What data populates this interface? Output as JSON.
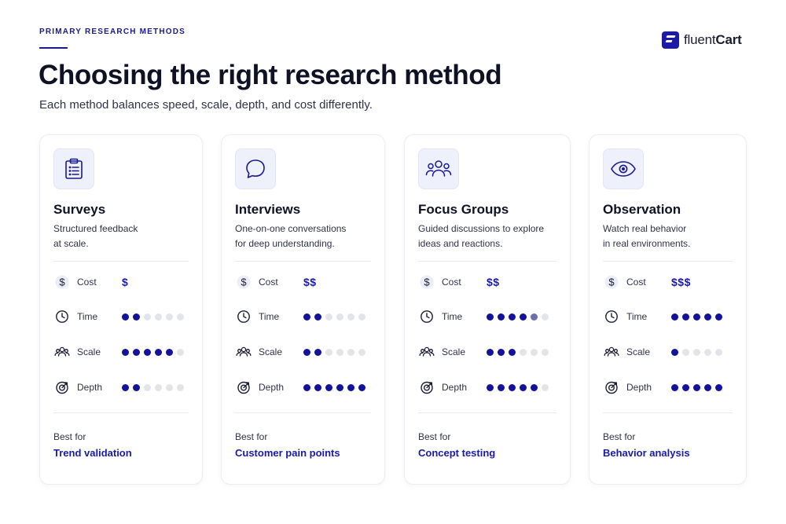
{
  "header": {
    "eyebrow": "PRIMARY RESEARCH METHODS",
    "title": "Choosing the right research method",
    "subtitle": "Each method balances speed, scale, depth, and cost differently."
  },
  "brand": {
    "name_light": "fluent",
    "name_bold": "Cart"
  },
  "labels": {
    "cost": "Cost",
    "time": "Time",
    "scale": "Scale",
    "depth": "Depth",
    "best_for": "Best for"
  },
  "colors": {
    "accent": "#1a1aa6",
    "dot_on": "#12129a",
    "dot_partial": "#6b70ad",
    "dot_off": "#e3e4ea"
  },
  "cards": [
    {
      "icon": "clipboard-icon",
      "title": "Surveys",
      "desc_1": "Structured feedback",
      "desc_2": "at scale.",
      "cost": "$",
      "time": {
        "filled": 2,
        "partial": 0,
        "total": 6
      },
      "scale": {
        "filled": 5,
        "partial": 0,
        "total": 6
      },
      "depth": {
        "filled": 2,
        "partial": 0,
        "total": 6
      },
      "best_for": "Trend validation"
    },
    {
      "icon": "chat-bubble-icon",
      "title": "Interviews",
      "desc_1": "One-on-one conversations",
      "desc_2": "for deep understanding.",
      "cost": "$$",
      "time": {
        "filled": 2,
        "partial": 0,
        "total": 6
      },
      "scale": {
        "filled": 2,
        "partial": 0,
        "total": 6
      },
      "depth": {
        "filled": 6,
        "partial": 0,
        "total": 6
      },
      "best_for": "Customer pain points"
    },
    {
      "icon": "group-icon",
      "title": "Focus Groups",
      "desc_1": "Guided discussions to explore",
      "desc_2": "ideas and reactions.",
      "cost": "$$",
      "time": {
        "filled": 4,
        "partial": 1,
        "total": 6
      },
      "scale": {
        "filled": 3,
        "partial": 0,
        "total": 6
      },
      "depth": {
        "filled": 5,
        "partial": 0,
        "total": 6
      },
      "best_for": "Concept testing"
    },
    {
      "icon": "eye-icon",
      "title": "Observation",
      "desc_1": "Watch real behavior",
      "desc_2": "in real environments.",
      "cost": "$$$",
      "time": {
        "filled": 5,
        "partial": 0,
        "total": 5
      },
      "scale": {
        "filled": 1,
        "partial": 0,
        "total": 5
      },
      "depth": {
        "filled": 5,
        "partial": 0,
        "total": 5
      },
      "best_for": "Behavior analysis"
    }
  ]
}
